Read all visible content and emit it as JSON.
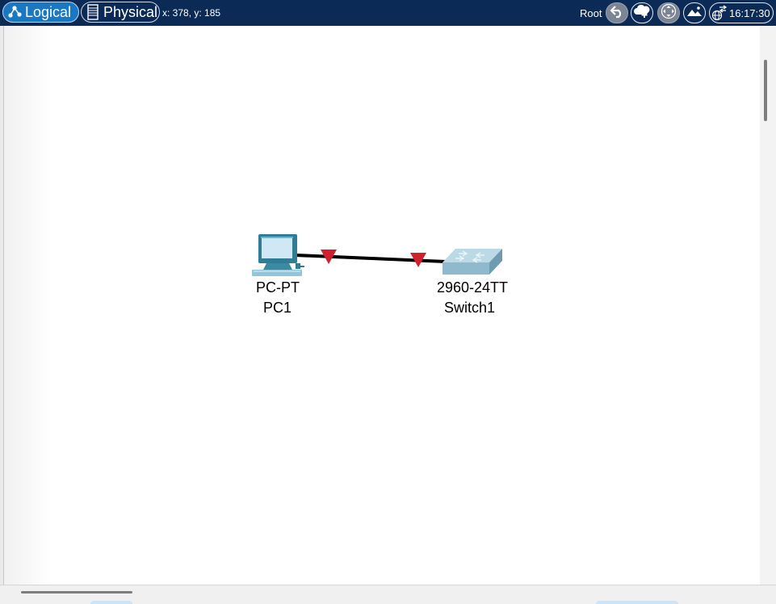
{
  "toolbar": {
    "tabs": [
      {
        "label": "Logical",
        "active": true,
        "icon": "logical-network-icon"
      },
      {
        "label": "Physical",
        "active": false,
        "icon": "physical-rack-icon"
      }
    ],
    "cursor_coords": "x: 378, y: 185",
    "root_label": "Root",
    "buttons": [
      {
        "name": "back-button",
        "icon": "back-arrow-icon"
      },
      {
        "name": "new-cluster-button",
        "icon": "cloud-add-icon"
      },
      {
        "name": "move-object-button",
        "icon": "move-arrows-icon"
      },
      {
        "name": "set-background-button",
        "icon": "landscape-image-icon"
      }
    ],
    "clock": {
      "time": "16:17:30",
      "icon": "viewport-globe-icon"
    }
  },
  "topology": {
    "devices": [
      {
        "id": "pc1",
        "model": "PC-PT",
        "name": "PC1",
        "type": "pc"
      },
      {
        "id": "switch1",
        "model": "2960-24TT",
        "name": "Switch1",
        "type": "switch"
      }
    ],
    "links": [
      {
        "from": "PC1",
        "to": "Switch1",
        "cable": "copper-straight-through",
        "from_status": "down",
        "to_status": "down"
      }
    ]
  },
  "colors": {
    "topbar_bg": "#0b2a56",
    "tab_active": "#1a78c2",
    "link_down": "#d0202e",
    "canvas": "#ffffff"
  }
}
